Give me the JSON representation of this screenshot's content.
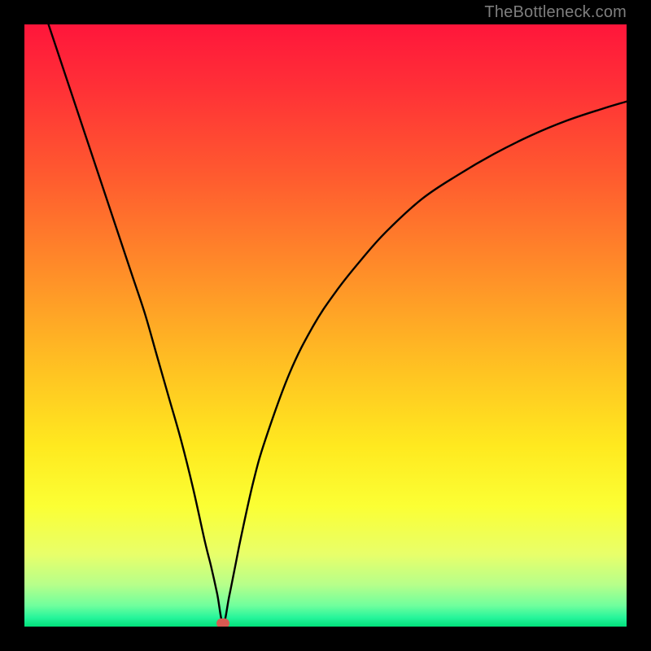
{
  "watermark": "TheBottleneck.com",
  "colors": {
    "frame": "#000000",
    "curve": "#000000",
    "dot": "#d85a52",
    "gradient_stops": [
      {
        "offset": 0.0,
        "color": "#ff163b"
      },
      {
        "offset": 0.1,
        "color": "#ff2f37"
      },
      {
        "offset": 0.25,
        "color": "#ff5a2f"
      },
      {
        "offset": 0.4,
        "color": "#ff8a29"
      },
      {
        "offset": 0.55,
        "color": "#ffbb23"
      },
      {
        "offset": 0.7,
        "color": "#ffe91f"
      },
      {
        "offset": 0.8,
        "color": "#fbff34"
      },
      {
        "offset": 0.88,
        "color": "#e8ff6a"
      },
      {
        "offset": 0.93,
        "color": "#b7ff8a"
      },
      {
        "offset": 0.965,
        "color": "#70ff9d"
      },
      {
        "offset": 0.985,
        "color": "#26f59b"
      },
      {
        "offset": 1.0,
        "color": "#01e07b"
      }
    ]
  },
  "chart_data": {
    "type": "line",
    "title": "",
    "xlabel": "",
    "ylabel": "",
    "xlim": [
      0,
      100
    ],
    "ylim": [
      0,
      100
    ],
    "x_min_at": 33,
    "dot": {
      "x": 33,
      "y": 0.5
    },
    "series": [
      {
        "name": "bottleneck-curve",
        "x": [
          4,
          6,
          8,
          10,
          12,
          14,
          16,
          18,
          20,
          22,
          24,
          26,
          28,
          30,
          31,
          32,
          33,
          34,
          35,
          36,
          38,
          40,
          44,
          48,
          52,
          56,
          60,
          66,
          72,
          78,
          84,
          90,
          96,
          100
        ],
        "y": [
          100,
          94,
          88,
          82,
          76,
          70,
          64,
          58,
          52,
          45,
          38,
          31,
          23,
          14,
          10,
          5.5,
          0.5,
          5,
          10,
          15,
          24,
          31,
          42,
          50,
          56,
          61,
          65.5,
          71,
          75,
          78.5,
          81.5,
          84,
          86,
          87.2
        ]
      }
    ]
  }
}
